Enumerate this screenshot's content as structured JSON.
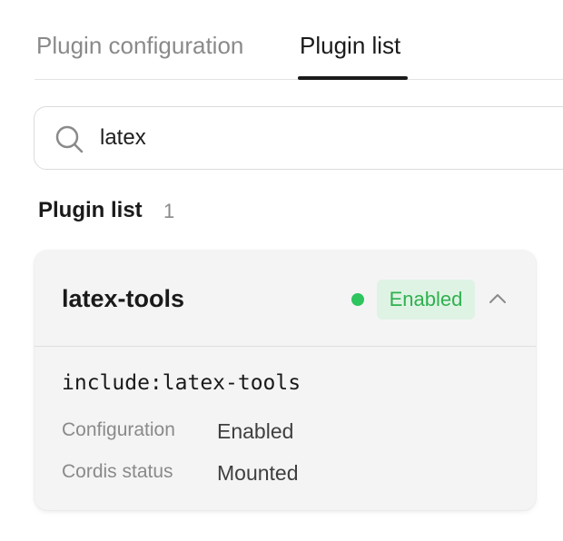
{
  "tabs": [
    {
      "label": "Plugin configuration",
      "active": false
    },
    {
      "label": "Plugin list",
      "active": true
    }
  ],
  "search": {
    "value": "latex",
    "icon": "search-icon"
  },
  "section": {
    "title": "Plugin list",
    "count": "1"
  },
  "plugin": {
    "name": "latex-tools",
    "status_label": "Enabled",
    "status_color": "#2ec45e",
    "expanded": true,
    "include": "include:latex-tools",
    "fields": [
      {
        "label": "Configuration",
        "value": "Enabled"
      },
      {
        "label": "Cordis status",
        "value": "Mounted"
      }
    ]
  }
}
